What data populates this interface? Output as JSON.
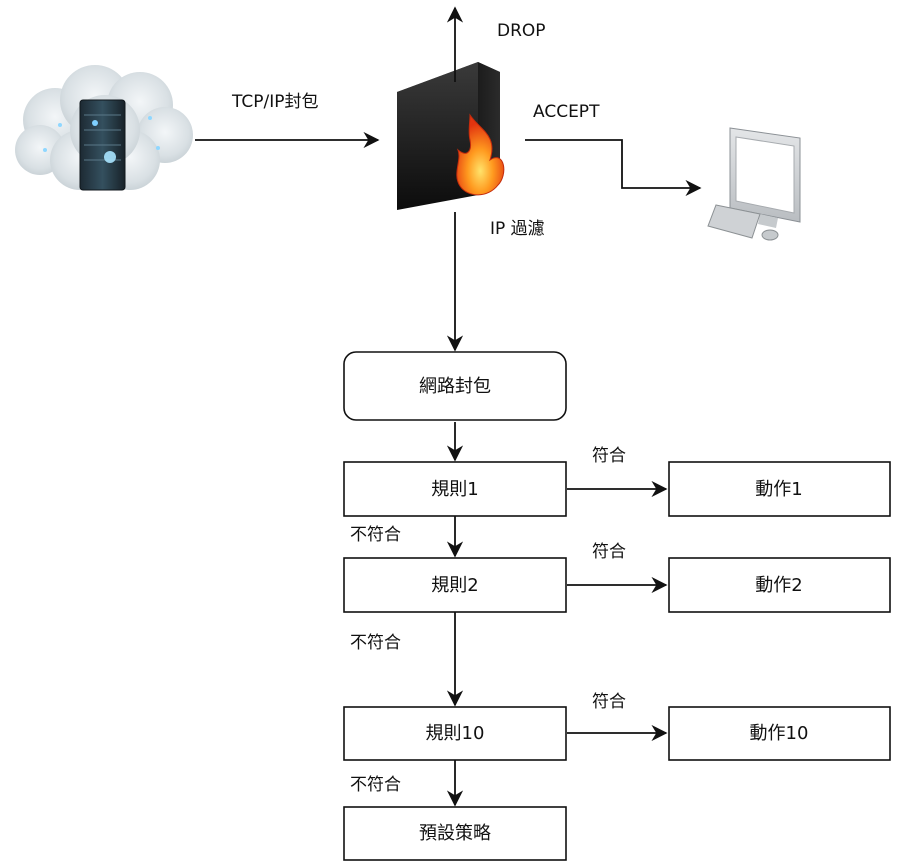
{
  "edge_labels": {
    "drop": "DROP",
    "tcp_packet": "TCP/IP封包",
    "accept": "ACCEPT",
    "ip_filter": "IP 過濾",
    "match_1": "符合",
    "match_2": "符合",
    "match_10": "符合",
    "no_match_1": "不符合",
    "no_match_2": "不符合",
    "no_match_10": "不符合"
  },
  "nodes": {
    "packet": "網路封包",
    "rule_1": "規則1",
    "rule_2": "規則2",
    "rule_10": "規則10",
    "action_1": "動作1",
    "action_2": "動作2",
    "action_10": "動作10",
    "default_policy": "預設策略"
  },
  "icons": {
    "source": "cloud-server-icon",
    "firewall": "firewall-icon",
    "destination": "computer-icon"
  }
}
